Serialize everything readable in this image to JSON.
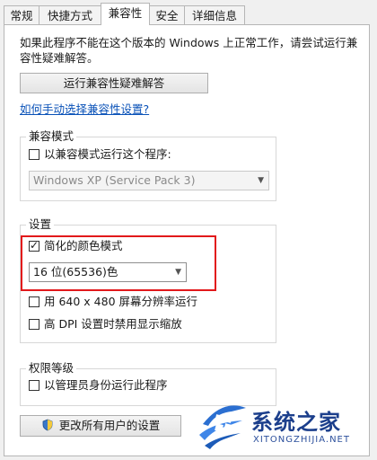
{
  "tabs": [
    "常规",
    "快捷方式",
    "兼容性",
    "安全",
    "详细信息"
  ],
  "active_tab": "兼容性",
  "intro_text_line1": "如果此程序不能在这个版本的 Windows 上正常工作，请尝试运行兼",
  "intro_text_line2": "容性疑难解答。",
  "troubleshooter_button": "运行兼容性疑难解答",
  "manual_link": "如何手动选择兼容性设置?",
  "compat_mode": {
    "title": "兼容模式",
    "checkbox_label": "以兼容模式运行这个程序:",
    "checked": false,
    "select_value": "Windows XP (Service Pack 3)"
  },
  "settings": {
    "title": "设置",
    "reduced_color": {
      "label": "简化的颜色模式",
      "checked": true
    },
    "color_select_value": "16 位(65536)色",
    "resolution": {
      "label": "用 640 x 480 屏幕分辨率运行",
      "checked": false
    },
    "dpi": {
      "label": "高 DPI 设置时禁用显示缩放",
      "checked": false
    }
  },
  "privilege": {
    "title": "权限等级",
    "admin": {
      "label": "以管理员身份运行此程序",
      "checked": false
    }
  },
  "all_users_button": "更改所有用户的设置",
  "watermark": {
    "name": "系统之家",
    "url": "XITONGZHIJIA.NET"
  },
  "colors": {
    "highlight_box": "#e2191b",
    "link": "#0a52b8"
  }
}
